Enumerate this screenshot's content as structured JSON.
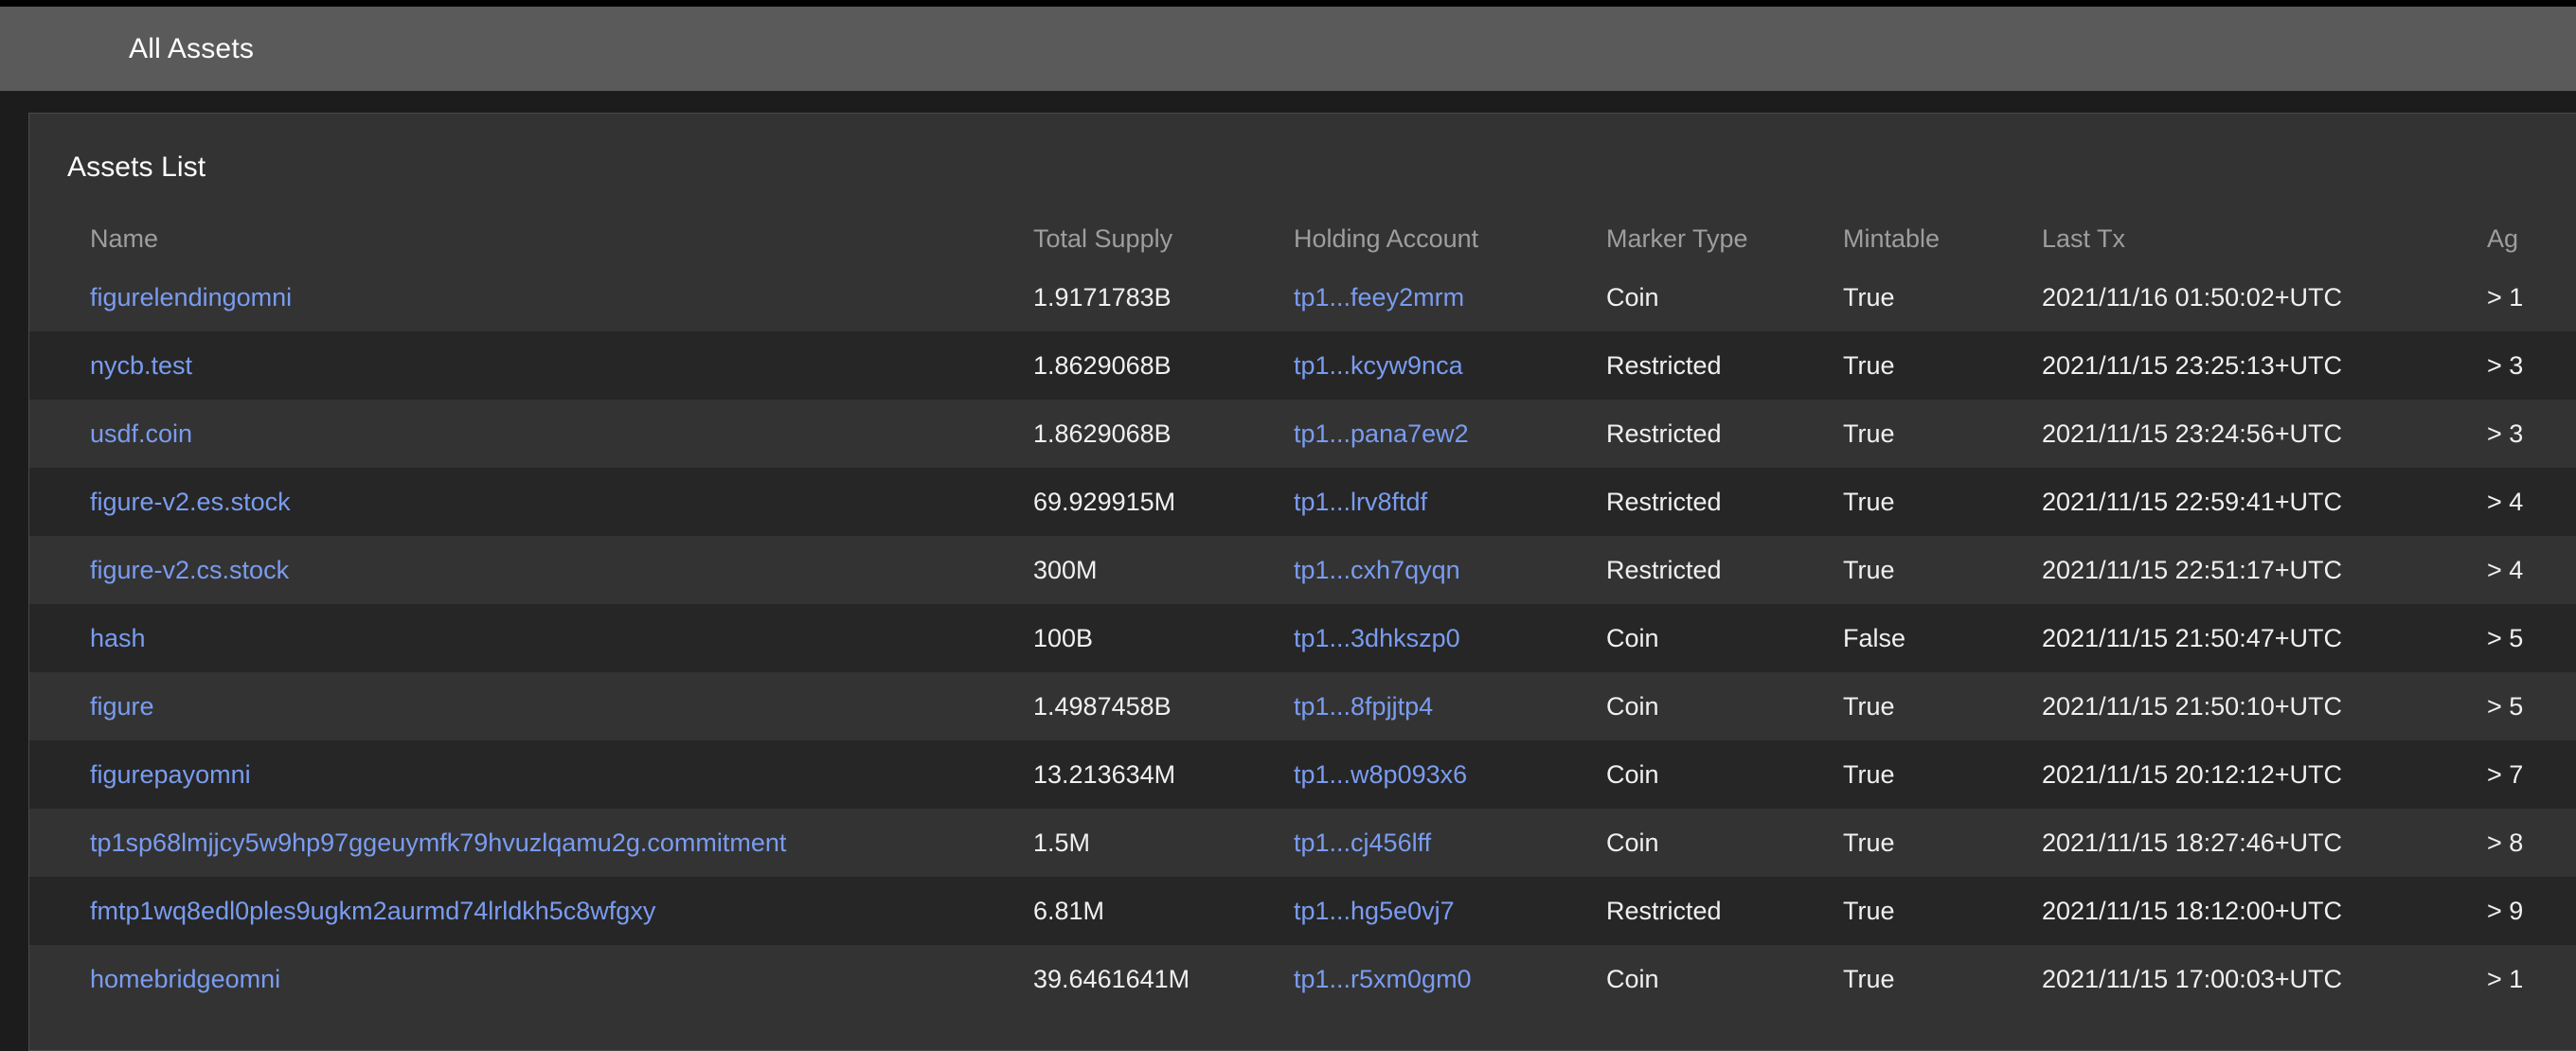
{
  "app": {
    "header_title": "All Assets",
    "header_bg": "#5a5a5a"
  },
  "card": {
    "title": "Assets List",
    "bg": "#333333",
    "border": "#4a4a4a"
  },
  "table": {
    "columns": [
      {
        "key": "name",
        "label": "Name"
      },
      {
        "key": "supply",
        "label": "Total Supply"
      },
      {
        "key": "holding",
        "label": "Holding Account"
      },
      {
        "key": "marker",
        "label": "Marker Type"
      },
      {
        "key": "mintable",
        "label": "Mintable"
      },
      {
        "key": "lasttx",
        "label": "Last Tx"
      },
      {
        "key": "age",
        "label": "Ag"
      }
    ],
    "link_color": "#7a9cf0",
    "rows": [
      {
        "name": "figurelendingomni",
        "supply": "1.9171783B",
        "holding": "tp1...feey2mrm",
        "marker": "Coin",
        "mintable": "True",
        "lasttx": "2021/11/16 01:50:02+UTC",
        "age": "> 1"
      },
      {
        "name": "nycb.test",
        "supply": "1.8629068B",
        "holding": "tp1...kcyw9nca",
        "marker": "Restricted",
        "mintable": "True",
        "lasttx": "2021/11/15 23:25:13+UTC",
        "age": "> 3"
      },
      {
        "name": "usdf.coin",
        "supply": "1.8629068B",
        "holding": "tp1...pana7ew2",
        "marker": "Restricted",
        "mintable": "True",
        "lasttx": "2021/11/15 23:24:56+UTC",
        "age": "> 3"
      },
      {
        "name": "figure-v2.es.stock",
        "supply": "69.929915M",
        "holding": "tp1...lrv8ftdf",
        "marker": "Restricted",
        "mintable": "True",
        "lasttx": "2021/11/15 22:59:41+UTC",
        "age": "> 4"
      },
      {
        "name": "figure-v2.cs.stock",
        "supply": "300M",
        "holding": "tp1...cxh7qyqn",
        "marker": "Restricted",
        "mintable": "True",
        "lasttx": "2021/11/15 22:51:17+UTC",
        "age": "> 4"
      },
      {
        "name": "hash",
        "supply": "100B",
        "holding": "tp1...3dhkszp0",
        "marker": "Coin",
        "mintable": "False",
        "lasttx": "2021/11/15 21:50:47+UTC",
        "age": "> 5"
      },
      {
        "name": "figure",
        "supply": "1.4987458B",
        "holding": "tp1...8fpjjtp4",
        "marker": "Coin",
        "mintable": "True",
        "lasttx": "2021/11/15 21:50:10+UTC",
        "age": "> 5"
      },
      {
        "name": "figurepayomni",
        "supply": "13.213634M",
        "holding": "tp1...w8p093x6",
        "marker": "Coin",
        "mintable": "True",
        "lasttx": "2021/11/15 20:12:12+UTC",
        "age": "> 7"
      },
      {
        "name": "tp1sp68lmjjcy5w9hp97ggeuymfk79hvuzlqamu2g.commitment",
        "supply": "1.5M",
        "holding": "tp1...cj456lff",
        "marker": "Coin",
        "mintable": "True",
        "lasttx": "2021/11/15 18:27:46+UTC",
        "age": "> 8"
      },
      {
        "name": "fmtp1wq8edl0ples9ugkm2aurmd74lrldkh5c8wfgxy",
        "supply": "6.81M",
        "holding": "tp1...hg5e0vj7",
        "marker": "Restricted",
        "mintable": "True",
        "lasttx": "2021/11/15 18:12:00+UTC",
        "age": "> 9"
      },
      {
        "name": "homebridgeomni",
        "supply": "39.6461641M",
        "holding": "tp1...r5xm0gm0",
        "marker": "Coin",
        "mintable": "True",
        "lasttx": "2021/11/15 17:00:03+UTC",
        "age": "> 1"
      }
    ]
  }
}
